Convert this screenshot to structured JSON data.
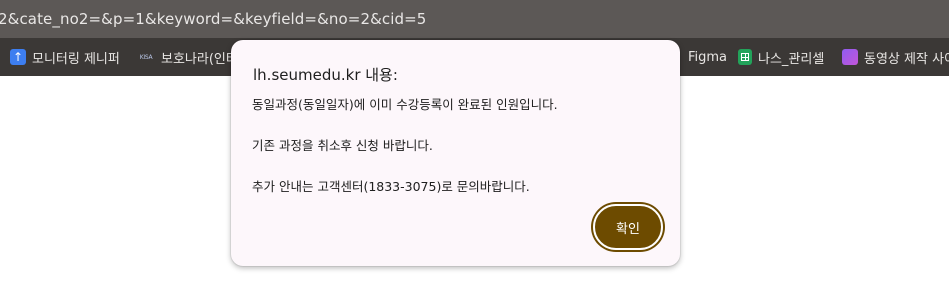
{
  "browser": {
    "url_fragment": "2&cate_no2=&p=1&keyword=&keyfield=&no=2&cid=5",
    "bookmarks": [
      {
        "label": "모니터링 제니퍼",
        "icon": "upload-arrow-icon",
        "icon_glyph": "↑",
        "icon_color": "#3d7ef0"
      },
      {
        "label": "보호나라(인터",
        "icon": "kisa-logo-icon",
        "icon_glyph": "KISA",
        "icon_color": "#b8c5e6"
      },
      {
        "label": "Figma",
        "icon": "figma-icon",
        "icon_glyph": ""
      },
      {
        "label": "나스_관리셀",
        "icon": "spreadsheet-icon",
        "icon_glyph": "",
        "icon_color": "#22a35a"
      },
      {
        "label": "동영상 제작 사이",
        "icon": "video-folder-icon",
        "icon_glyph": "",
        "icon_color": "#8f5cf0"
      }
    ]
  },
  "dialog": {
    "title": "lh.seumedu.kr 내용:",
    "lines": [
      "동일과정(동일일자)에 이미 수강등록이 완료된 인원입니다.",
      "기존 과정을 취소후 신청 바랍니다.",
      "추가 안내는 고객센터(1833-3075)로 문의바랍니다."
    ],
    "ok_label": "확인",
    "accent_color": "#6d4b00"
  }
}
